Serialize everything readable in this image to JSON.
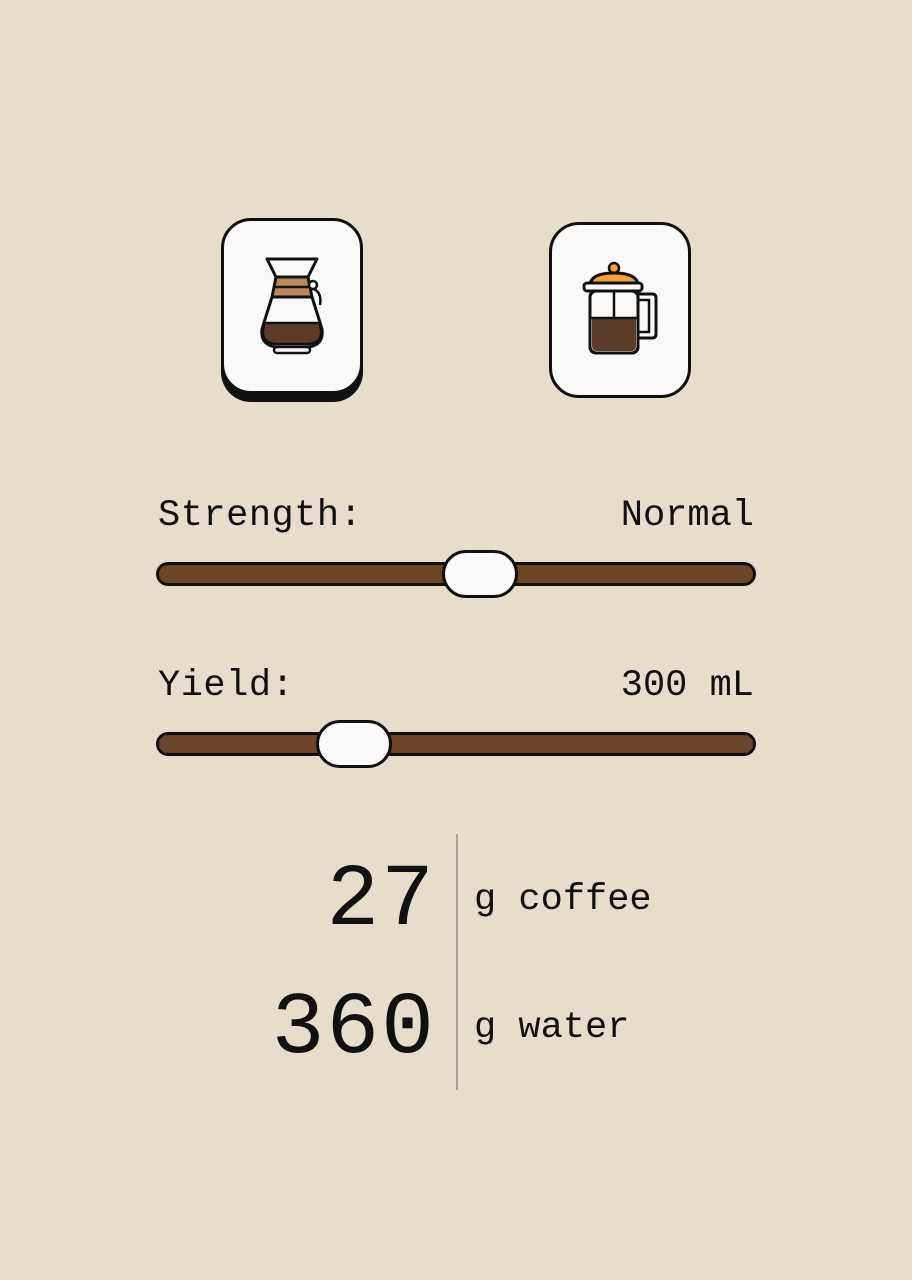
{
  "brewers": [
    {
      "name": "Chemex",
      "icon": "chemex-icon",
      "selected": true
    },
    {
      "name": "French Press",
      "icon": "french-press-icon",
      "selected": false
    }
  ],
  "strength": {
    "label": "Strength:",
    "value": "Normal",
    "slider_fraction": 0.54
  },
  "yield": {
    "label": "Yield:",
    "value": "300 mL",
    "slider_fraction": 0.33
  },
  "result": {
    "coffee_amount": "27",
    "coffee_unit": "g coffee",
    "water_amount": "360",
    "water_unit": "g water"
  },
  "colors": {
    "background": "#e6ddcd",
    "track": "#6d4427",
    "card": "#faf9f7",
    "outline": "#111111",
    "coffee_dark": "#5b3a29",
    "filter_tan": "#b68a5e",
    "lid_orange": "#f0a43a"
  }
}
